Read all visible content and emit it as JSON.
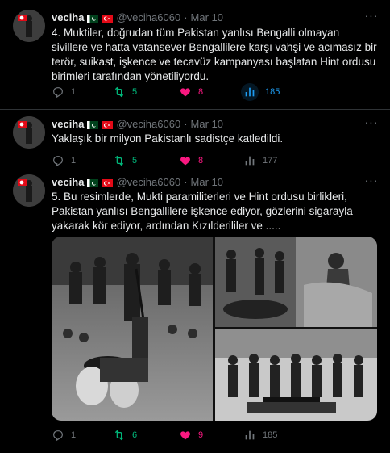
{
  "tweets": [
    {
      "name": "veciha",
      "handle": "@veciha6060",
      "dot": "·",
      "date": "Mar 10",
      "text": "4. Muktiler, doğrudan tüm Pakistan yanlısı Bengalli olmayan sivillere ve hatta vatansever Bengallilere karşı vahşi ve acımasız bir terör, suikast, işkence ve tecavüz kampanyası başlatan Hint ordusu birimleri tarafından yönetiliyordu.",
      "replies": "1",
      "retweets": "5",
      "likes": "8",
      "views": "185"
    },
    {
      "name": "veciha",
      "handle": "@veciha6060",
      "dot": "·",
      "date": "Mar 10",
      "text": "Yaklaşık bir milyon Pakistanlı sadistçe katledildi.",
      "replies": "1",
      "retweets": "5",
      "likes": "8",
      "views": "177"
    },
    {
      "name": "veciha",
      "handle": "@veciha6060",
      "dot": "·",
      "date": "Mar 10",
      "text": "5. Bu resimlerde, Mukti paramiliterleri ve Hint ordusu birlikleri, Pakistan yanlısı Bengallilere işkence ediyor, gözlerini sigarayla yakarak kör ediyor, ardından Kızılderililer ve .....",
      "replies": "1",
      "retweets": "6",
      "likes": "9",
      "views": "185"
    }
  ],
  "colors": {
    "retweet": "#00ba7c",
    "like": "#f91880",
    "views": "#1d9bf0",
    "muted": "#71767b",
    "flag_pk": "#01411c",
    "flag_tr": "#e30a17"
  },
  "icons": [
    "reply-icon",
    "retweet-icon",
    "heart-icon",
    "analytics-icon",
    "more-icon"
  ]
}
